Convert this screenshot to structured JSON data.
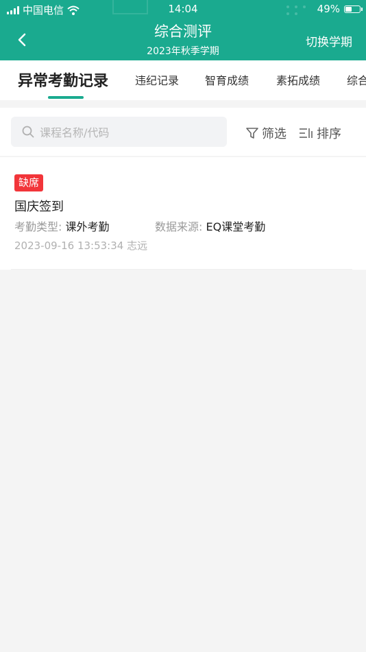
{
  "status_bar": {
    "carrier": "中国电信",
    "time": "14:04",
    "battery": "49%",
    "battery_level": 0.49
  },
  "header": {
    "title": "综合测评",
    "subtitle": "2023年秋季学期",
    "switch_label": "切换学期",
    "back_icon": "chevron-left-icon"
  },
  "tabs": [
    {
      "label": "异常考勤记录",
      "active": true
    },
    {
      "label": "违纪记录",
      "active": false
    },
    {
      "label": "智育成绩",
      "active": false
    },
    {
      "label": "素拓成绩",
      "active": false
    },
    {
      "label": "综合",
      "active": false
    }
  ],
  "search": {
    "placeholder": "课程名称/代码",
    "value": ""
  },
  "toolbar": {
    "filter_label": "筛选",
    "sort_label": "排序"
  },
  "records": [
    {
      "badge": "缺席",
      "title": "国庆签到",
      "type_label": "考勤类型:",
      "type_value": "课外考勤",
      "source_label": "数据来源:",
      "source_value": "EQ课堂考勤",
      "timestamp": "2023-09-16 13:53:34 志远"
    }
  ],
  "colors": {
    "brand": "#1aaa8f",
    "badge_red": "#f2353a",
    "background": "#f4f4f4"
  }
}
